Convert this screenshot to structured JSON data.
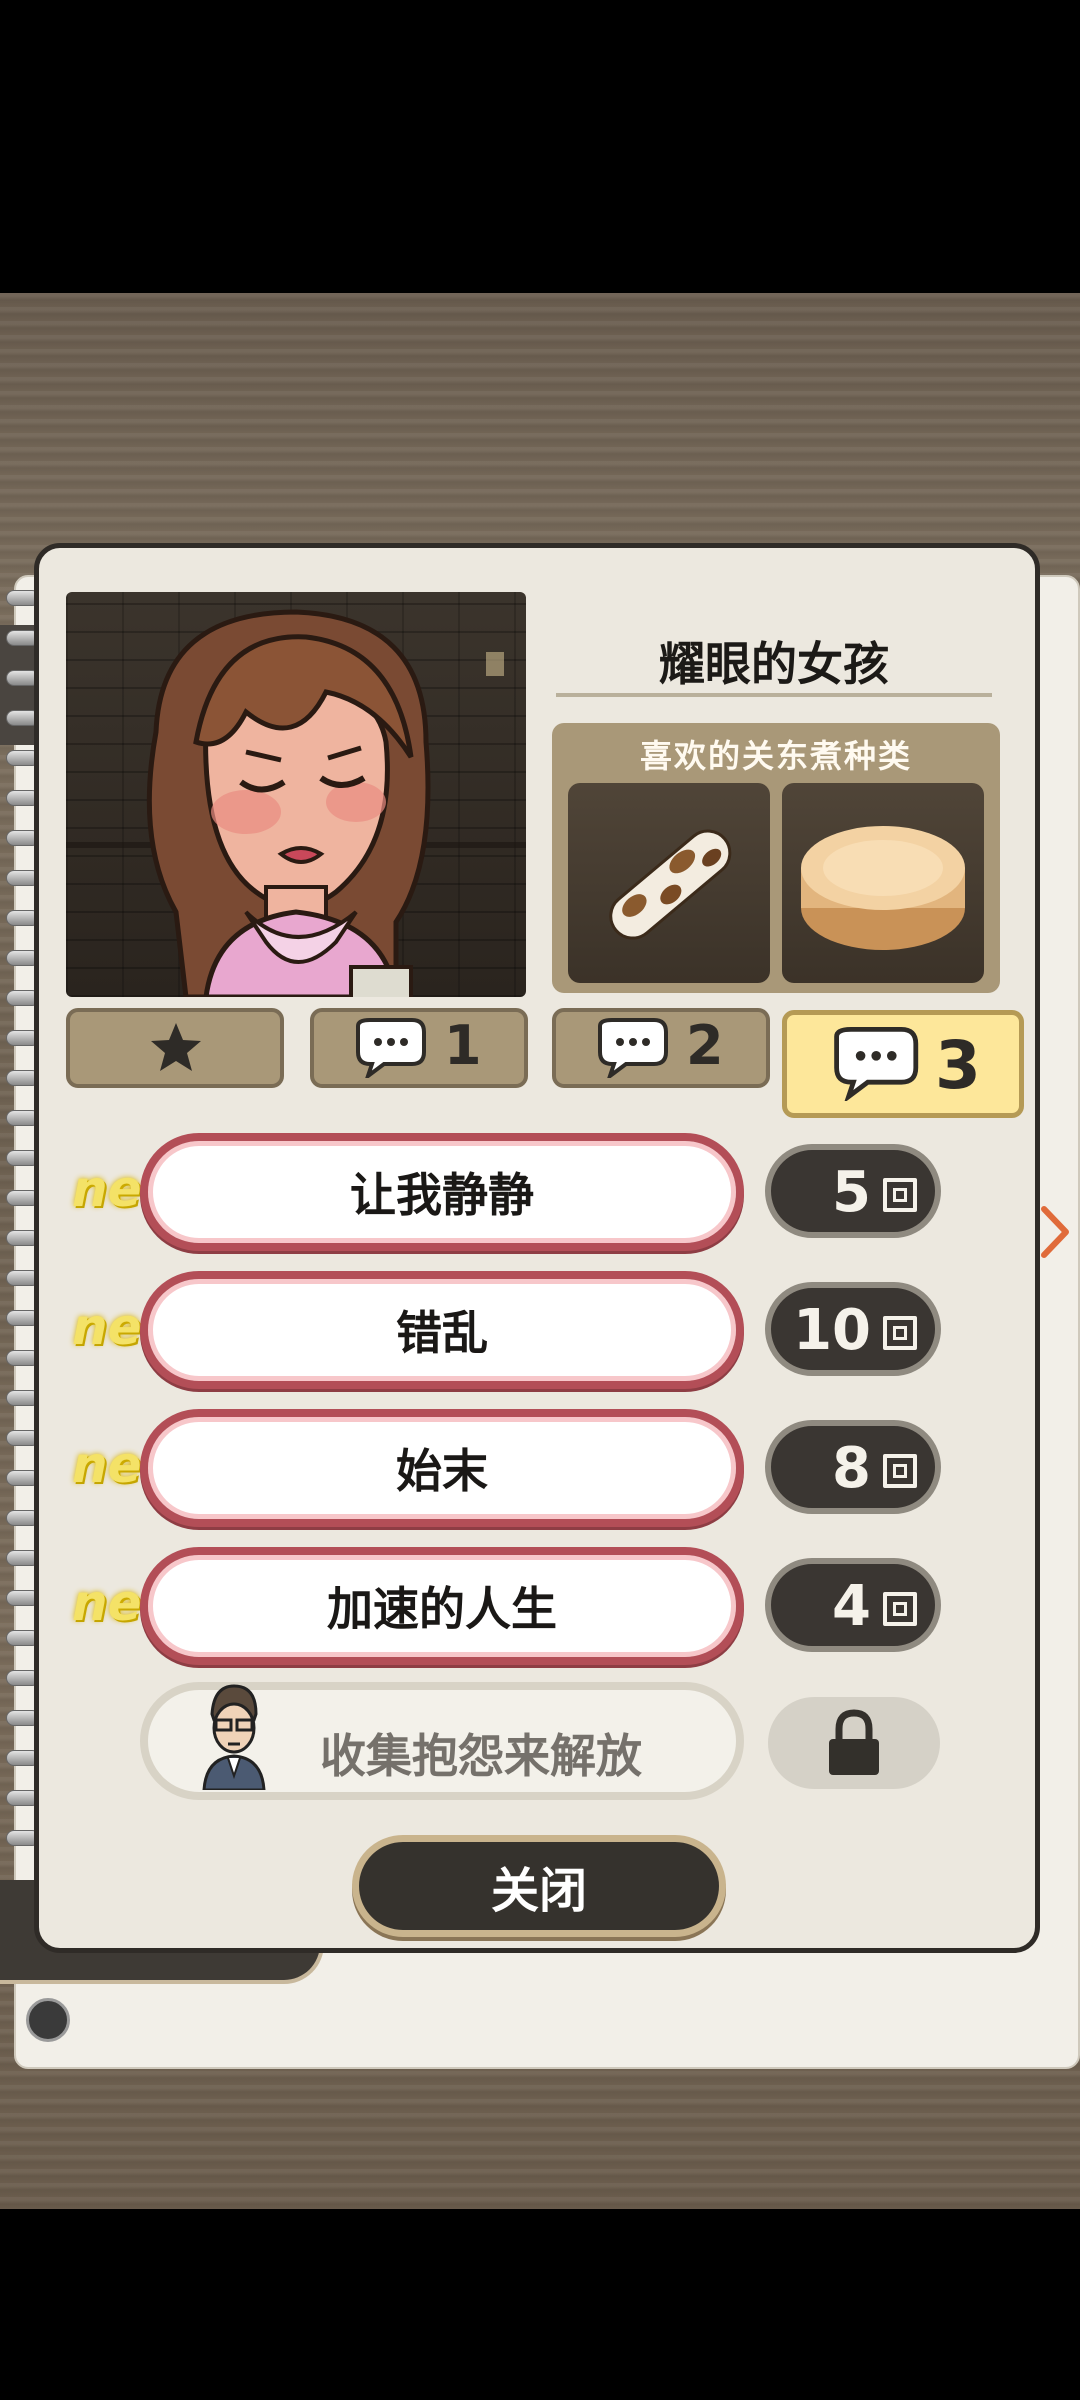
{
  "character": {
    "name": "耀眼的女孩",
    "favorites_title": "喜欢的关东煮种类",
    "favorites": [
      "chikuwa-icon",
      "daikon-icon"
    ]
  },
  "tabs": [
    {
      "icon": "star-icon",
      "label": ""
    },
    {
      "icon": "speech-bubble-icon",
      "label": "1"
    },
    {
      "icon": "speech-bubble-icon",
      "label": "2"
    },
    {
      "icon": "speech-bubble-icon",
      "label": "3",
      "active": true
    }
  ],
  "episodes": [
    {
      "badge": "new!",
      "title": "让我静静",
      "count": "5"
    },
    {
      "badge": "new!",
      "title": "错乱",
      "count": "10"
    },
    {
      "badge": "new!",
      "title": "始末",
      "count": "8"
    },
    {
      "badge": "new!",
      "title": "加速的人生",
      "count": "4"
    }
  ],
  "locked": {
    "text": "收集抱怨来解放"
  },
  "close_label": "关闭",
  "colors": {
    "accent_pink": "#b34e57",
    "new_yellow": "#f4e267",
    "panel_bg": "#ece8df",
    "active_tab": "#fde79a"
  }
}
